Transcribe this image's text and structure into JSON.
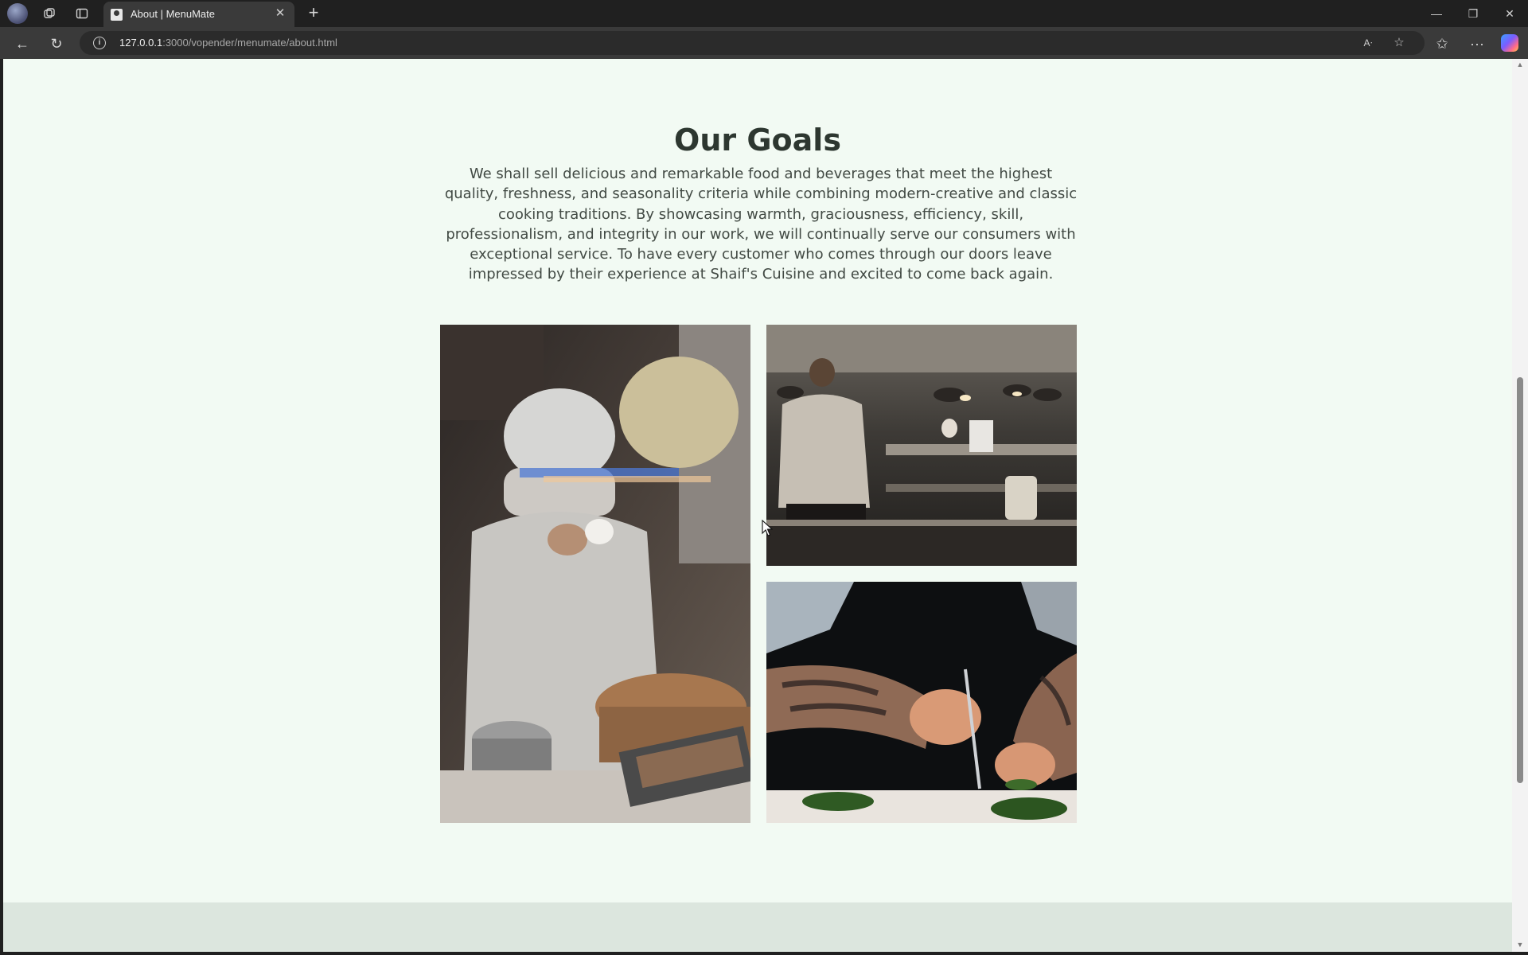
{
  "browser": {
    "tab_title": "About | MenuMate",
    "url_host": "127.0.0.1",
    "url_path": ":3000/vopender/menumate/about.html",
    "icons": [
      "profile-avatar",
      "workspaces-icon",
      "tab-actions-icon",
      "close-icon",
      "plus-icon",
      "back-icon",
      "refresh-icon",
      "info-icon",
      "read-aloud-icon",
      "favorite-star-icon",
      "favorites-icon",
      "more-icon",
      "copilot-icon",
      "minimize-icon",
      "restore-icon",
      "close-window-icon"
    ]
  },
  "page": {
    "goals_title": "Our Goals",
    "goals_text": "We shall sell delicious and remarkable food and beverages that meet the highest quality, freshness, and seasonality criteria while combining modern-creative and classic cooking traditions. By showcasing warmth, graciousness, efficiency, skill, professionalism, and integrity in our work, we will continually serve our consumers with exceptional service. To have every customer who comes through our doors leave impressed by their experience at Shaif's Cuisine and excited to come back again."
  },
  "colors": {
    "page_background": "#f2faf3",
    "heading": "#2d3730",
    "body_text": "#424a44",
    "footer_band": "#dce6de",
    "browser_frame": "#202020",
    "toolbar": "#3a3a3a"
  }
}
